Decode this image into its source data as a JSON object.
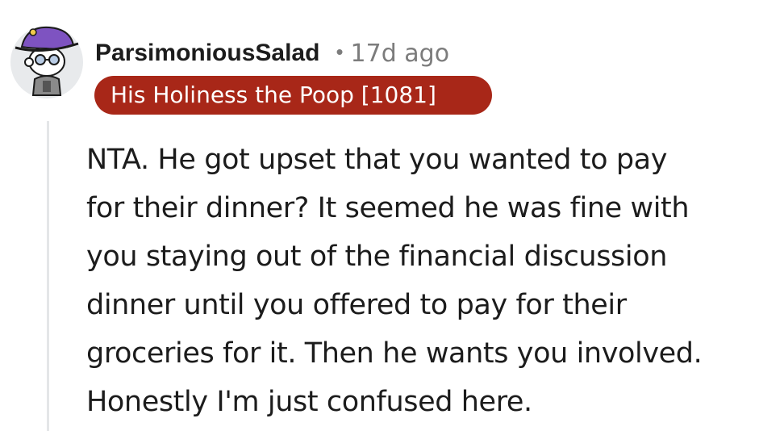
{
  "comment": {
    "author": "ParsimoniousSalad",
    "separator": "•",
    "timestamp": "17d ago",
    "flair": "His Holiness the Poop [1081]",
    "avatar_icon": "snoo-avatar-purple-hat",
    "body_lines": [
      "NTA. He got upset that you wanted to pay",
      "for their dinner? It seemed he was fine with",
      "you staying out of the financial discussion",
      "dinner until you offered to pay for their",
      "groceries for it. Then he wants you involved.",
      "Honestly I'm just confused here."
    ]
  },
  "colors": {
    "flair_background": "#a82718",
    "flair_text": "#ffffff",
    "meta_text": "#7c7c7c",
    "body_text": "#1c1c1c",
    "thread_line": "#e4e6e8",
    "avatar_hat": "#7e53c1"
  }
}
